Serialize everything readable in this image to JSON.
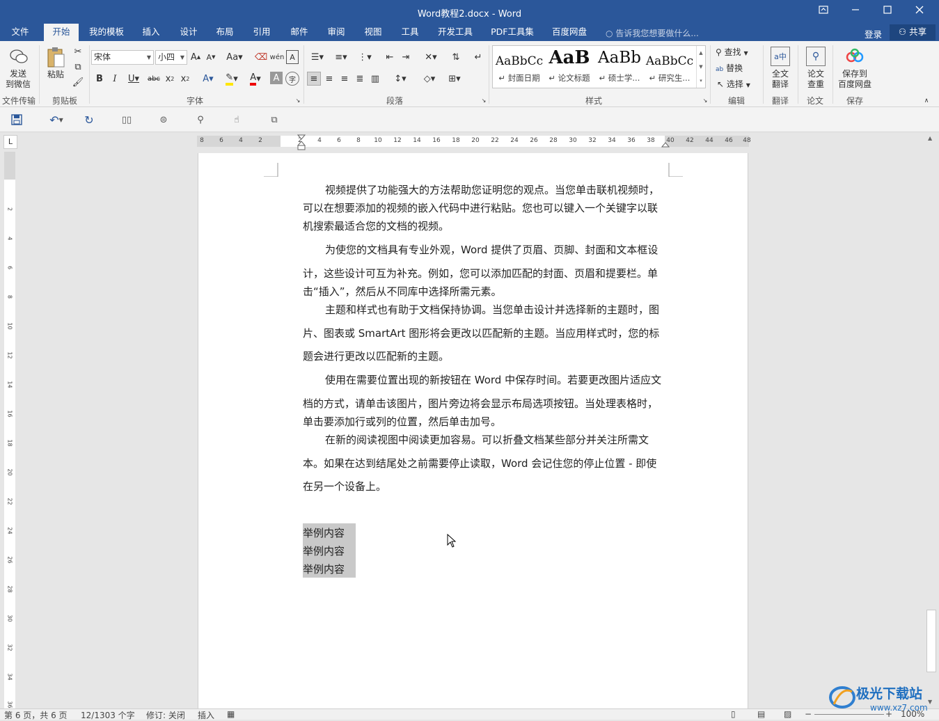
{
  "window": {
    "title": "Word教程2.docx - Word",
    "controls": [
      "restore-ribbon",
      "minimize",
      "maximize",
      "close"
    ]
  },
  "tabs": [
    {
      "label": "文件"
    },
    {
      "label": "开始",
      "active": true
    },
    {
      "label": "我的模板"
    },
    {
      "label": "插入"
    },
    {
      "label": "设计"
    },
    {
      "label": "布局"
    },
    {
      "label": "引用"
    },
    {
      "label": "邮件"
    },
    {
      "label": "审阅"
    },
    {
      "label": "视图"
    },
    {
      "label": "工具"
    },
    {
      "label": "开发工具"
    },
    {
      "label": "PDF工具集"
    },
    {
      "label": "百度网盘"
    }
  ],
  "tell_me": "告诉我您想要做什么...",
  "login": "登录",
  "share": "共享",
  "ribbon": {
    "send_wechat": "发送\n到微信",
    "paste": "粘贴",
    "font_name": "宋体",
    "font_size": "小四",
    "styles": [
      {
        "sample": "AaBbCc",
        "name": "↵ 封面日期"
      },
      {
        "sample": "AaB",
        "name": "↵ 论文标题"
      },
      {
        "sample": "AaBb",
        "name": "↵ 硕士学..."
      },
      {
        "sample": "AaBbCc",
        "name": "↵ 研究生..."
      }
    ],
    "find": "查找",
    "replace": "替换",
    "select": "选择",
    "full_translate": "全文\n翻译",
    "paper_check": "论文\n查重",
    "save_baidu": "保存到\n百度网盘",
    "groups": {
      "g1": "文件传输",
      "g2": "剪贴板",
      "g3": "字体",
      "g4": "段落",
      "g5": "样式",
      "g6": "编辑",
      "g7": "翻译",
      "g8": "论文",
      "g9": "保存"
    }
  },
  "ruler": {
    "h_left": [
      "8",
      "6",
      "4",
      "2"
    ],
    "h_main": [
      "2",
      "4",
      "6",
      "8",
      "10",
      "12",
      "14",
      "16",
      "18",
      "20",
      "22",
      "24",
      "26",
      "28",
      "30",
      "32",
      "34",
      "36",
      "38"
    ],
    "h_right": [
      "40",
      "42",
      "44",
      "46",
      "48"
    ],
    "v": [
      "2",
      "4",
      "6",
      "8",
      "10",
      "12",
      "14",
      "16",
      "18",
      "20",
      "22",
      "24",
      "26",
      "28",
      "30",
      "32",
      "34",
      "36"
    ]
  },
  "document": {
    "paragraphs": [
      [
        "视频提供了功能强大的方法帮助您证明您的观点。当您单击联机视频时，",
        "可以在想要添加的视频的嵌入代码中进行粘贴。您也可以键入一个关键字以联",
        "机搜索最适合您的文档的视频。"
      ],
      [
        "为使您的文档具有专业外观，Word 提供了页眉、页脚、封面和文本框设",
        "计，这些设计可互为补充。例如，您可以添加匹配的封面、页眉和提要栏。单",
        "击“插入”，然后从不同库中选择所需元素。"
      ],
      [
        "主题和样式也有助于文档保持协调。当您单击设计并选择新的主题时，图",
        "片、图表或 SmartArt 图形将会更改以匹配新的主题。当应用样式时，您的标",
        "题会进行更改以匹配新的主题。"
      ],
      [
        "使用在需要位置出现的新按钮在 Word 中保存时间。若要更改图片适应文",
        "档的方式，请单击该图片，图片旁边将会显示布局选项按钮。当处理表格时，",
        "单击要添加行或列的位置，然后单击加号。"
      ],
      [
        "在新的阅读视图中阅读更加容易。可以折叠文档某些部分并关注所需文",
        "本。如果在达到结尾处之前需要停止读取，Word 会记住您的停止位置 - 即使",
        "在另一个设备上。"
      ]
    ],
    "selected_lines": [
      "举例内容",
      "举例内容",
      "举例内容"
    ]
  },
  "status": {
    "page": "第 6 页，共 6 页",
    "words": "12/1303 个字",
    "track": "修订: 关闭",
    "insert": "插入",
    "zoom": "100%"
  },
  "watermark": {
    "brand": "极光下载站",
    "url": "www.xz7.com"
  },
  "colors": {
    "accent": "#2b579a",
    "selection": "#c9c9c9"
  }
}
